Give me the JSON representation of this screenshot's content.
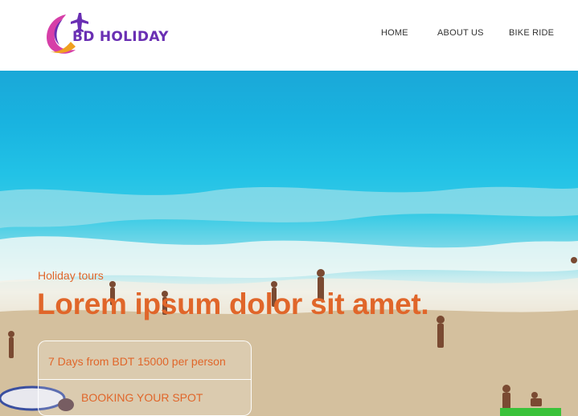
{
  "brand": {
    "name": "BD HOLIDAY",
    "logo_icon": "airplane-swoosh-icon",
    "colors": {
      "purple": "#6a2fb3",
      "magenta": "#d63fa8",
      "orange": "#f0a020"
    }
  },
  "nav": {
    "items": [
      {
        "label": "HOME"
      },
      {
        "label": "ABOUT US"
      },
      {
        "label": "BIKE RIDE"
      }
    ]
  },
  "hero": {
    "image": "beach-aerial-photo",
    "subtitle": "Holiday tours",
    "title": "Lorem ipsum dolor sit amet.",
    "accent_color": "#e0662a",
    "card": {
      "price_text": "7 Days from BDT 15000 per person",
      "cta_label": "BOOKING YOUR SPOT"
    }
  }
}
